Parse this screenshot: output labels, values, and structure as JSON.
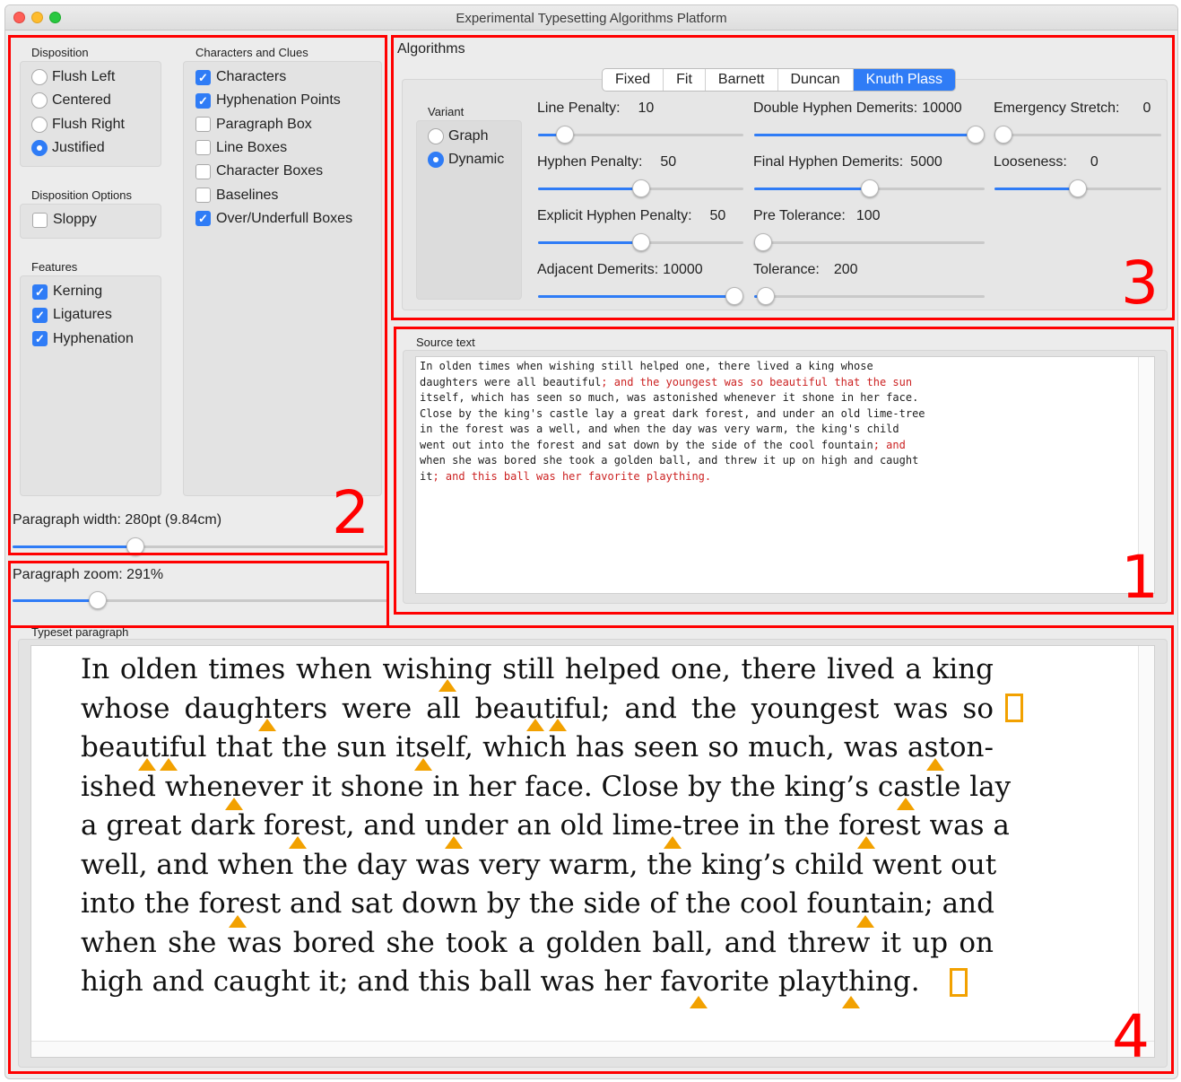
{
  "window": {
    "title": "Experimental Typesetting Algorithms Platform"
  },
  "disposition": {
    "title": "Disposition",
    "options": [
      {
        "label": "Flush Left",
        "selected": false
      },
      {
        "label": "Centered",
        "selected": false
      },
      {
        "label": "Flush Right",
        "selected": false
      },
      {
        "label": "Justified",
        "selected": true
      }
    ]
  },
  "disposition_options": {
    "title": "Disposition Options",
    "sloppy": {
      "label": "Sloppy",
      "checked": false
    }
  },
  "features": {
    "title": "Features",
    "items": [
      {
        "label": "Kerning",
        "checked": true
      },
      {
        "label": "Ligatures",
        "checked": true
      },
      {
        "label": "Hyphenation",
        "checked": true
      }
    ]
  },
  "clues": {
    "title": "Characters and Clues",
    "items": [
      {
        "label": "Characters",
        "checked": true
      },
      {
        "label": "Hyphenation Points",
        "checked": true
      },
      {
        "label": "Paragraph Box",
        "checked": false
      },
      {
        "label": "Line Boxes",
        "checked": false
      },
      {
        "label": "Character Boxes",
        "checked": false
      },
      {
        "label": "Baselines",
        "checked": false
      },
      {
        "label": "Over/Underfull Boxes",
        "checked": true
      }
    ]
  },
  "paragraph_width": {
    "label": "Paragraph width: 280pt (9.84cm)",
    "fraction": 0.33
  },
  "paragraph_zoom": {
    "label": "Paragraph zoom: 291%",
    "fraction": 0.225
  },
  "algorithms": {
    "title": "Algorithms",
    "tabs": [
      "Fixed",
      "Fit",
      "Barnett",
      "Duncan",
      "Knuth Plass"
    ],
    "active_tab": "Knuth Plass",
    "variant": {
      "title": "Variant",
      "options": [
        {
          "label": "Graph",
          "selected": false
        },
        {
          "label": "Dynamic",
          "selected": true
        }
      ]
    },
    "params": {
      "line_penalty": {
        "label": "Line Penalty:",
        "value": "10",
        "fraction": 0.13
      },
      "hyphen_penalty": {
        "label": "Hyphen Penalty:",
        "value": "50",
        "fraction": 0.5
      },
      "explicit_hyphen_penalty": {
        "label": "Explicit Hyphen Penalty:",
        "value": "50",
        "fraction": 0.5
      },
      "adjacent_demerits": {
        "label": "Adjacent Demerits:",
        "value": "10000",
        "fraction": 0.96
      },
      "double_hyphen_demerits": {
        "label": "Double Hyphen Demerits:",
        "value": "10000",
        "fraction": 0.96
      },
      "final_hyphen_demerits": {
        "label": "Final Hyphen Demerits:",
        "value": "5000",
        "fraction": 0.5
      },
      "pre_tolerance": {
        "label": "Pre Tolerance:",
        "value": "100",
        "fraction": 0.04
      },
      "tolerance": {
        "label": "Tolerance:",
        "value": "200",
        "fraction": 0.05
      },
      "emergency_stretch": {
        "label": "Emergency Stretch:",
        "value": "0",
        "fraction": 0.04
      },
      "looseness": {
        "label": "Looseness:",
        "value": "0",
        "fraction": 0.5
      }
    }
  },
  "source_text": {
    "title": "Source text",
    "lines": [
      [
        "In olden times when wishing still helped one, there lived a king whose",
        ""
      ],
      [
        "daughters were all beautiful",
        "; and the youngest was so beautiful that the sun"
      ],
      [
        "itself, which has seen so much, was astonished whenever it shone in her face.",
        ""
      ],
      [
        "Close by the king's castle lay a great dark forest, and under an old lime-tree",
        ""
      ],
      [
        "in the forest was a well, and when the day was very warm, the king's child",
        ""
      ],
      [
        "went out into the forest and sat down by the side of the cool fountain",
        "; and"
      ],
      [
        "when she was bored she took a golden ball, and threw it up on high and caught",
        ""
      ],
      [
        "it",
        "; and this ball was her favorite plaything."
      ]
    ]
  },
  "typeset": {
    "title": "Typeset paragraph",
    "lines": [
      "In olden times when wishing still helped one, there lived a king",
      "whose daughters were all beautiful; and the youngest was so",
      "beautiful that the sun itself, which has seen so much, was aston-",
      "ished whenever it shone in her face. Close by the king’s castle lay",
      "a great dark forest, and under an old lime-tree in the forest was a",
      "well, and when the day was very warm, the king’s child went out",
      "into the forest and sat down by the side of the cool fountain; and",
      "when she was bored she took a golden ball, and threw it up on",
      "high and caught it; and this ball was her favorite plaything."
    ]
  },
  "annotations": [
    "1",
    "2",
    "3",
    "4"
  ],
  "colors": {
    "accent": "#2f7cf6",
    "annotation": "#ff0000",
    "hyphen_marker": "#f2a100",
    "source_highlight": "#cc2222"
  }
}
